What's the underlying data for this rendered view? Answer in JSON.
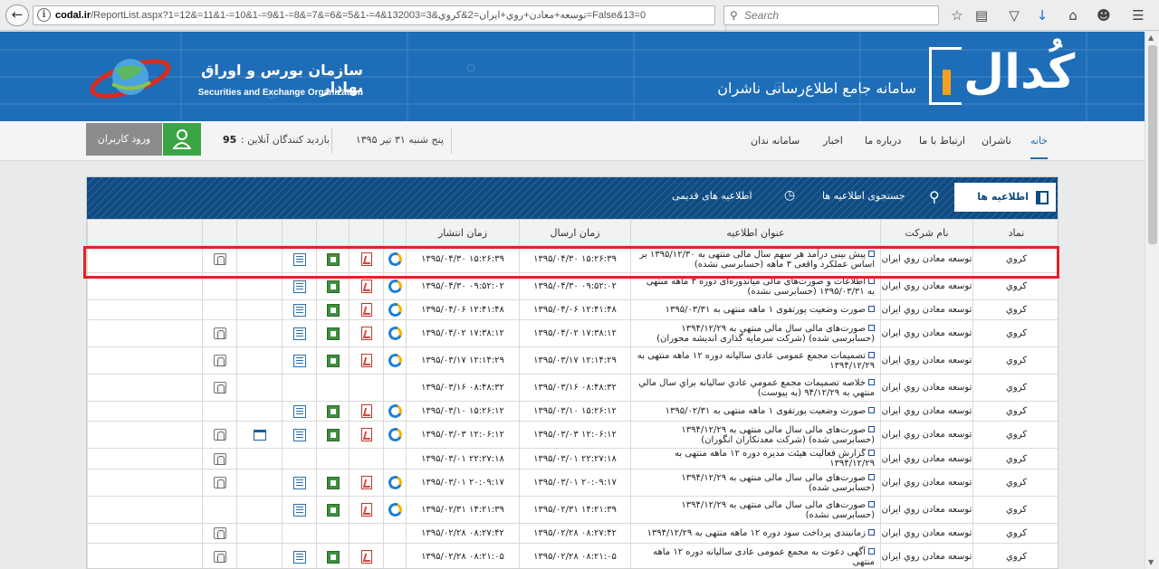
{
  "browser": {
    "url_host": "codal.ir",
    "url_path": "/ReportList.aspx?1=12&=11&1-=10&1-=9&1-=8&=7&=6&=5&1-=4&132003=3&توسعه+معادن+روي+ايران=2&كروي=False&13=0",
    "search_placeholder": "Search"
  },
  "header": {
    "org_fa": "سازمان بورس و اوراق بهادار",
    "org_en": "Securities and Exchange Organization",
    "system_title": "سامانه جامع اطلاع‌رسانی ناشران",
    "brand_word": "کُدال"
  },
  "navbar": {
    "login_label": "ورود کاربران",
    "online_label": "بازدید کنندگان آنلاین :",
    "online_count": "95",
    "date": "پنج شنبه ۳۱ تیر ۱۳۹۵",
    "menu": [
      "خانه",
      "ناشران",
      "ارتباط با ما",
      "درباره ما",
      "اخبار",
      "سامانه ندان"
    ]
  },
  "panel": {
    "tabs": {
      "letters": "اطلاعیه ها",
      "search": "جستجوی اطلاعیه ها",
      "old": "اطلاعیه های قدیمی"
    },
    "columns": {
      "symbol": "نماد",
      "company": "نام شرکت",
      "title": "عنوان اطلاعیه",
      "sent": "زمان ارسال",
      "published": "زمان انتشار"
    },
    "rows": [
      {
        "symbol": "كروي",
        "company": "توسعه معادن روي ايران",
        "title": "پیش بینی درآمد هر سهم سال مالی منتهی به ۱۳۹۵/۱۲/۳۰ بر اساس عملکرد واقعی ۳ ماهه (حسابرسی نشده)",
        "sent": "۱۳۹۵/۰۴/۳۰ ۱۵:۲۶:۳۹",
        "published": "۱۳۹۵/۰۴/۳۰ ۱۵:۲۶:۳۹",
        "icons": [
          "ie",
          "pdf",
          "xls",
          "doc",
          "",
          "att"
        ]
      },
      {
        "symbol": "كروي",
        "company": "توسعه معادن روي ايران",
        "title": "اطلاعات و صورت‌های مالی میاندوره‌ای دوره ۳ ماهه منتهی به ۱۳۹۵/۰۳/۳۱ (حسابرسی نشده)",
        "sent": "۱۳۹۵/۰۴/۳۰ ۰۹:۵۲:۰۲",
        "published": "۱۳۹۵/۰۴/۳۰ ۰۹:۵۲:۰۲",
        "icons": [
          "ie",
          "pdf",
          "xls",
          "doc",
          "",
          ""
        ]
      },
      {
        "symbol": "كروي",
        "company": "توسعه معادن روي ايران",
        "title": "صورت وضعیت پورتفوی ۱ ماهه منتهی به ۱۳۹۵/۰۳/۳۱",
        "sent": "۱۳۹۵/۰۴/۰۶ ۱۲:۴۱:۴۸",
        "published": "۱۳۹۵/۰۴/۰۶ ۱۲:۴۱:۴۸",
        "icons": [
          "ie",
          "pdf",
          "xls",
          "doc",
          "",
          ""
        ]
      },
      {
        "symbol": "كروي",
        "company": "توسعه معادن روي ايران",
        "title": "صورت‌های مالی سال مالی منتهی به ۱۳۹۴/۱۲/۲۹ (حسابرسی شده) (شرکت سرمایه گذاری اندیشه محوران)",
        "sent": "۱۳۹۵/۰۴/۰۲ ۱۷:۳۸:۱۲",
        "published": "۱۳۹۵/۰۴/۰۲ ۱۷:۳۸:۱۲",
        "icons": [
          "ie",
          "pdf",
          "xls",
          "doc",
          "",
          "att"
        ]
      },
      {
        "symbol": "كروي",
        "company": "توسعه معادن روي ايران",
        "title": "تصمیمات مجمع عمومی عادی سالیانه دوره ۱۲ ماهه منتهی به ۱۳۹۴/۱۲/۲۹",
        "sent": "۱۳۹۵/۰۳/۱۷ ۱۲:۱۴:۲۹",
        "published": "۱۳۹۵/۰۳/۱۷ ۱۲:۱۴:۲۹",
        "icons": [
          "ie",
          "pdf",
          "xls",
          "doc",
          "",
          "att"
        ]
      },
      {
        "symbol": "كروي",
        "company": "توسعه معادن روي ايران",
        "title": "خلاصه تصميمات مجمع عمومي عادي ساليانه براي سال مالي منتهي به ۹۴/۱۲/۲۹ (به پيوست)",
        "sent": "۱۳۹۵/۰۳/۱۶ ۰۸:۴۸:۳۲",
        "published": "۱۳۹۵/۰۳/۱۶ ۰۸:۴۸:۳۲",
        "icons": [
          "",
          "",
          "",
          "",
          "",
          "att"
        ]
      },
      {
        "symbol": "كروي",
        "company": "توسعه معادن روي ايران",
        "title": "صورت وضعیت پورتفوی ۱ ماهه منتهی به ۱۳۹۵/۰۲/۳۱",
        "sent": "۱۳۹۵/۰۳/۱۰ ۱۵:۲۶:۱۲",
        "published": "۱۳۹۵/۰۳/۱۰ ۱۵:۲۶:۱۲",
        "icons": [
          "ie",
          "pdf",
          "xls",
          "doc",
          "",
          ""
        ]
      },
      {
        "symbol": "كروي",
        "company": "توسعه معادن روي ايران",
        "title": "صورت‌های مالی سال مالی منتهی به ۱۳۹۴/۱۲/۲۹ (حسابرسی شده) (شرکت معدنکاران انگوران)",
        "sent": "۱۳۹۵/۰۳/۰۳ ۱۲:۰۶:۱۲",
        "published": "۱۳۹۵/۰۳/۰۳ ۱۲:۰۶:۱۲",
        "icons": [
          "ie",
          "pdf",
          "xls",
          "doc",
          "xbrl",
          "att"
        ]
      },
      {
        "symbol": "كروي",
        "company": "توسعه معادن روي ايران",
        "title": "گزارش فعالیت هیئت مدیره دوره ۱۲ ماهه منتهی به ۱۳۹۴/۱۲/۲۹",
        "sent": "۱۳۹۵/۰۳/۰۱ ۲۲:۲۷:۱۸",
        "published": "۱۳۹۵/۰۳/۰۱ ۲۲:۲۷:۱۸",
        "icons": [
          "",
          "",
          "",
          "",
          "",
          "att"
        ]
      },
      {
        "symbol": "كروي",
        "company": "توسعه معادن روي ايران",
        "title": "صورت‌های مالی سال مالی منتهی به ۱۳۹۴/۱۲/۲۹ (حسابرسی شده)",
        "sent": "۱۳۹۵/۰۳/۰۱ ۲۰:۰۹:۱۷",
        "published": "۱۳۹۵/۰۳/۰۱ ۲۰:۰۹:۱۷",
        "icons": [
          "ie",
          "pdf",
          "xls",
          "doc",
          "",
          "att"
        ]
      },
      {
        "symbol": "كروي",
        "company": "توسعه معادن روي ايران",
        "title": "صورت‌های مالی سال مالی منتهی به ۱۳۹۴/۱۲/۲۹ (حسابرسی نشده)",
        "sent": "۱۳۹۵/۰۲/۳۱ ۱۴:۲۱:۳۹",
        "published": "۱۳۹۵/۰۲/۳۱ ۱۴:۲۱:۳۹",
        "icons": [
          "ie",
          "pdf",
          "xls",
          "doc",
          "",
          ""
        ]
      },
      {
        "symbol": "كروي",
        "company": "توسعه معادن روي ايران",
        "title": "زمانبندی پرداخت سود دوره ۱۲ ماهه منتهی به ۱۳۹۴/۱۲/۲۹",
        "sent": "۱۳۹۵/۰۲/۲۸ ۰۸:۲۷:۴۲",
        "published": "۱۳۹۵/۰۲/۲۸ ۰۸:۲۷:۴۲",
        "icons": [
          "",
          "",
          "",
          "",
          "",
          "att"
        ]
      },
      {
        "symbol": "كروي",
        "company": "توسعه معادن روي ايران",
        "title": "آگهی دعوت به مجمع عمومی عادی سالیانه دوره ۱۲ ماهه منتهی",
        "sent": "۱۳۹۵/۰۲/۲۸ ۰۸:۲۱:۰۵",
        "published": "۱۳۹۵/۰۲/۲۸ ۰۸:۲۱:۰۵",
        "icons": [
          "",
          "pdf",
          "xls",
          "doc",
          "",
          "att"
        ]
      }
    ]
  },
  "colors": {
    "header_blue": "#1e6db8",
    "panel_navy": "#0f4c83",
    "accent_orange": "#f6a11d",
    "login_green": "#3ba545",
    "highlight_red": "#e0222a"
  }
}
